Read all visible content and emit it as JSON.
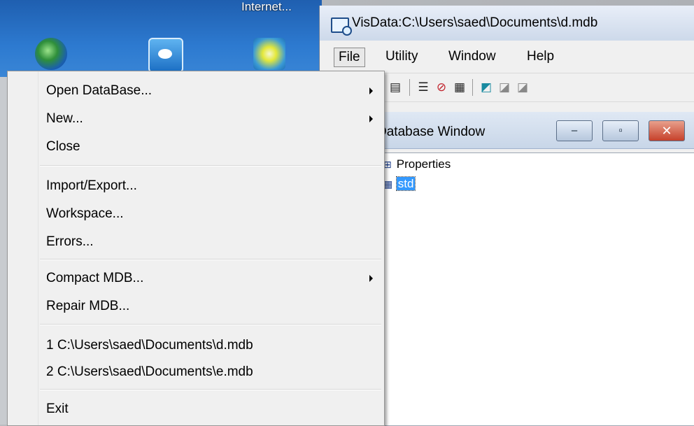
{
  "desktop": {
    "icon_label": "Internet...",
    "icons": [
      "globe-icon",
      "teamviewer-icon",
      "sun-icon"
    ]
  },
  "window": {
    "title": "VisData:C:\\Users\\saed\\Documents\\d.mdb",
    "menu": [
      "File",
      "Utility",
      "Window",
      "Help"
    ]
  },
  "db_window": {
    "title": "Database Window",
    "minimize": "–",
    "restore": "▫",
    "close": "✕",
    "tree": [
      {
        "label": "Properties",
        "icon": "properties-icon"
      },
      {
        "label": "std",
        "icon": "table-icon",
        "selected": true
      }
    ]
  },
  "file_menu": {
    "items": [
      {
        "label": "Open DataBase...",
        "submenu": true
      },
      {
        "label": "New...",
        "submenu": true
      },
      {
        "label": "Close",
        "submenu": false
      },
      {
        "label": "Import/Export...",
        "submenu": false
      },
      {
        "label": "Workspace...",
        "submenu": false
      },
      {
        "label": "Errors...",
        "submenu": false
      },
      {
        "label": "Compact MDB...",
        "submenu": true
      },
      {
        "label": "Repair MDB...",
        "submenu": false
      },
      {
        "label": "1 C:\\Users\\saed\\Documents\\d.mdb",
        "submenu": false
      },
      {
        "label": "2 C:\\Users\\saed\\Documents\\e.mdb",
        "submenu": false
      },
      {
        "label": "Exit",
        "submenu": false
      }
    ]
  },
  "colors": {
    "selection": "#3399ff",
    "close_button": "#c6402a",
    "title_gradient": "#cdd9ea"
  }
}
